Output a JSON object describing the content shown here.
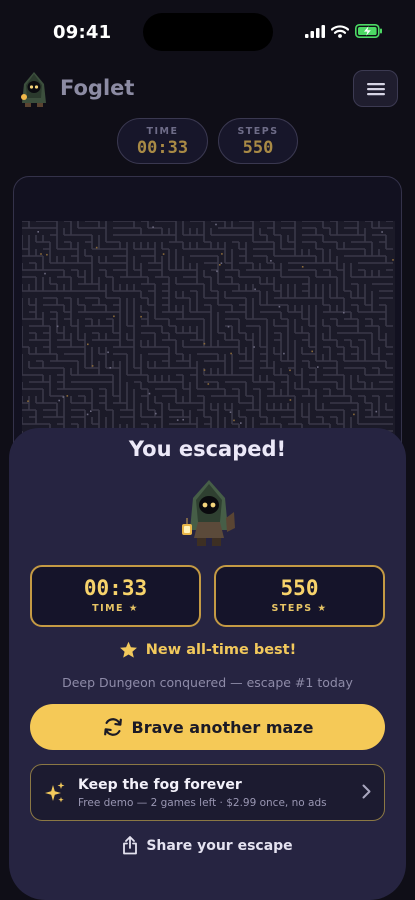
{
  "status_bar": {
    "time": "09:41"
  },
  "header": {
    "title": "Foglet"
  },
  "hud": {
    "time_label": "TIME",
    "time_value": "00:33",
    "steps_label": "STEPS",
    "steps_value": "550"
  },
  "result": {
    "title": "You escaped!",
    "time_value": "00:33",
    "time_label": "TIME ★",
    "steps_value": "550",
    "steps_label": "STEPS ★",
    "best_text": "New all-time best!",
    "conquered_text": "Deep Dungeon conquered — escape #1 today",
    "cta_label": "Brave another maze",
    "upsell_title": "Keep the fog forever",
    "upsell_subtitle": "Free demo — 2 games left · $2.99 once, no ads",
    "share_label": "Share your escape"
  },
  "icons": {
    "signal": "cellular-signal-icon",
    "wifi": "wifi-icon",
    "battery": "battery-charging-icon",
    "menu": "hamburger-menu-icon",
    "star": "star-icon",
    "refresh": "refresh-icon",
    "sparkle": "sparkles-icon",
    "chevron": "chevron-right-icon",
    "share": "share-icon"
  },
  "colors": {
    "accent": "#f5c957",
    "background": "#0f0e17",
    "sheet": "#262441",
    "gold_border": "#c49a44"
  }
}
